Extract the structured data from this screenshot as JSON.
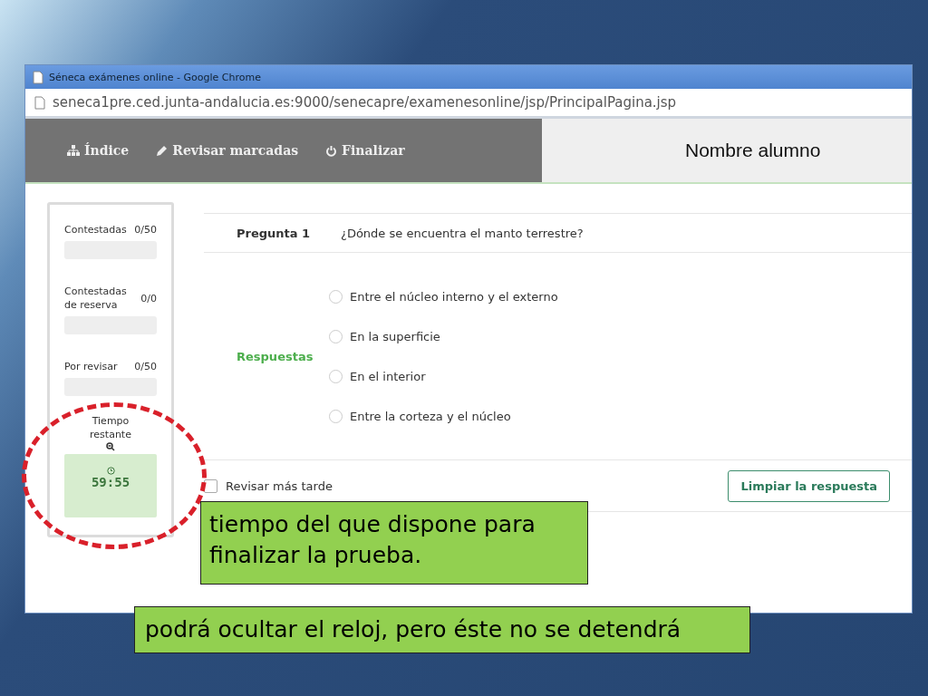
{
  "window": {
    "title": "Séneca exámenes online - Google Chrome",
    "url": "seneca1pre.ced.junta-andalucia.es:9000/senecapre/examenesonline/jsp/PrincipalPagina.jsp"
  },
  "nav": {
    "items": [
      {
        "kind": "index",
        "label": "Índice"
      },
      {
        "kind": "edit",
        "label": "Revisar marcadas"
      },
      {
        "kind": "power",
        "label": "Finalizar"
      }
    ],
    "student": "Nombre alumno"
  },
  "sidebar": {
    "stats": [
      {
        "label": "Contestadas",
        "count": "0/50",
        "level": 0
      },
      {
        "label": "Contestadas de reserva",
        "count": "0/0",
        "level": 0
      },
      {
        "label": "Por revisar",
        "count": "0/50",
        "level": 0
      }
    ],
    "timer": {
      "label": "Tiempo restante",
      "time": "59:55"
    }
  },
  "question": {
    "number": "Pregunta 1",
    "text": "¿Dónde se encuentra el manto terrestre?",
    "answers_label": "Respuestas",
    "answers": [
      {
        "text": "Entre el núcleo interno y el externo",
        "selected": false
      },
      {
        "text": "En la superficie",
        "selected": false
      },
      {
        "text": "En el interior",
        "selected": false
      },
      {
        "text": "Entre la corteza y el núcleo",
        "selected": false
      }
    ],
    "review_later": {
      "label": "Revisar más tarde",
      "checked": false
    },
    "clear_button": "Limpiar la respuesta"
  },
  "callouts": [
    {
      "text": "tiempo del que dispone para finalizar la prueba."
    },
    {
      "text": "podrá ocultar el reloj, pero éste no se detendrá"
    }
  ]
}
